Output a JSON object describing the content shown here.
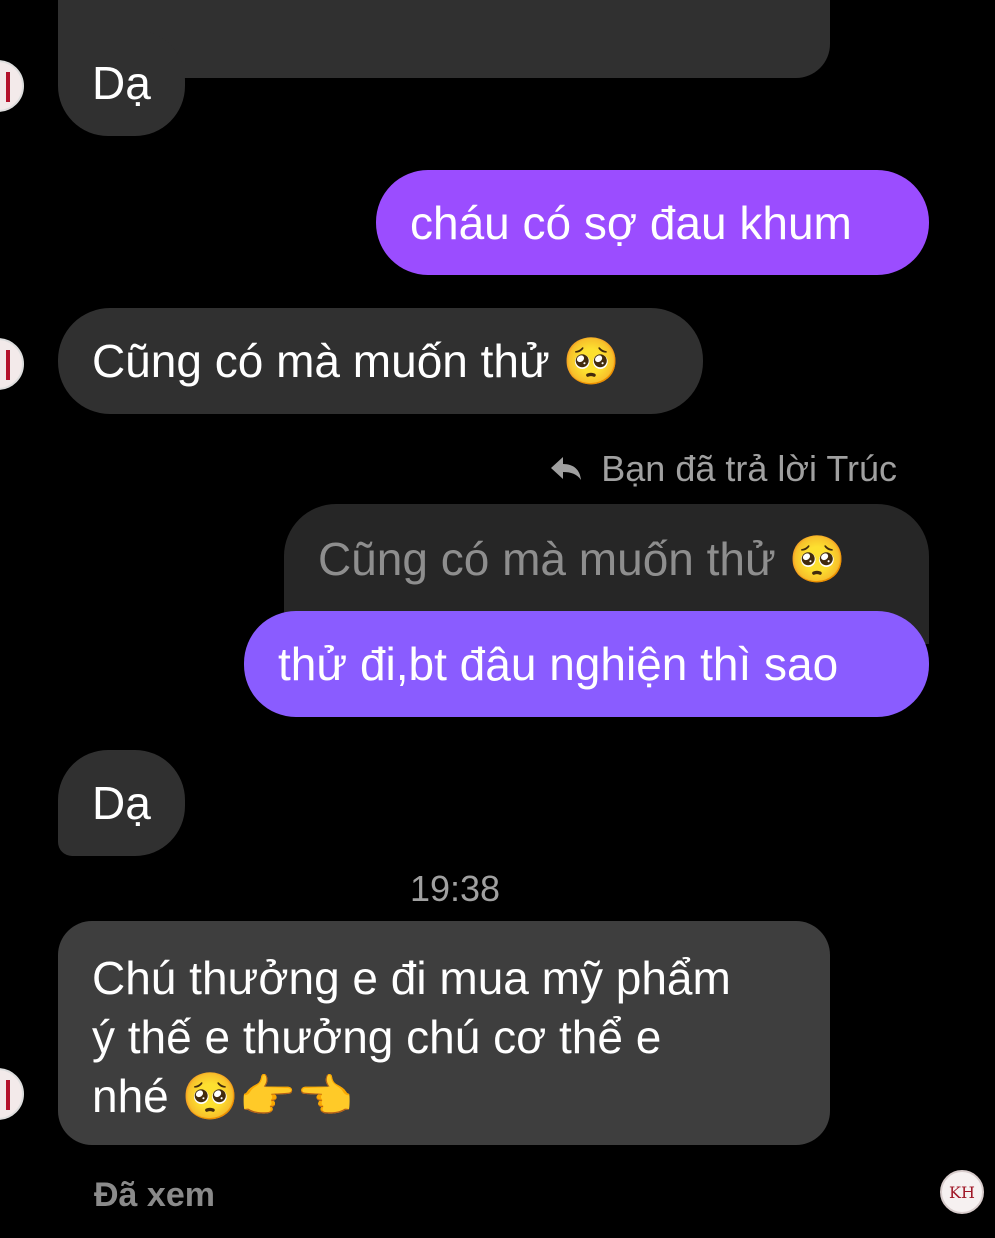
{
  "messages": [
    {
      "text": "Dạ"
    },
    {
      "text": "cháu có sợ đau khum"
    },
    {
      "text": "Cũng có mà muốn thử",
      "emoji": "🥺"
    },
    {
      "reply_header": "Bạn đã trả lời Trúc",
      "quoted": "Cũng có mà muốn thử",
      "quoted_emoji": "🥺",
      "text": "thử đi,bt đâu nghiện thì sao"
    },
    {
      "text": "Dạ"
    },
    {
      "lines": [
        "Chú thưởng e đi mua mỹ phẩm",
        "ý thế e thưởng chú cơ thể e",
        "nhé"
      ],
      "emoji": "🥺👉👈"
    }
  ],
  "timestamp": "19:38",
  "status": "Đã xem",
  "seen_avatar_text": "KH",
  "colors": {
    "outgoing_top": "#9b4dff",
    "outgoing_bottom": "#8a5cff",
    "incoming": "#303030",
    "background": "#000000"
  }
}
